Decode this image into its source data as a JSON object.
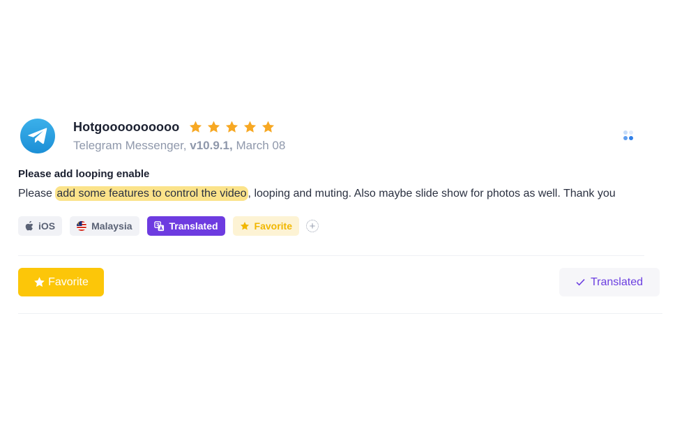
{
  "review": {
    "app_icon": "telegram-logo-icon",
    "author": "Hotgoooooooooo",
    "rating": 5,
    "rating_max": 5,
    "star_color": "#f7a823",
    "meta": {
      "app_name": "Telegram Messenger,",
      "version": "v10.9.1,",
      "date": "March 08"
    },
    "title": "Please add looping enable",
    "body": {
      "before": "Please ",
      "highlighted": "add some features to control the video",
      "after": ", looping and muting. Also maybe slide show for photos as well. Thank you"
    },
    "highlight_color": "#fbe38a"
  },
  "tags": {
    "platform": {
      "icon": "apple-icon",
      "label": "iOS"
    },
    "country": {
      "icon": "malaysia-flag-icon",
      "label": "Malaysia"
    },
    "translated": {
      "icon": "translate-icon",
      "label": "Translated",
      "color": "#6d3be0"
    },
    "favorite": {
      "icon": "star-icon",
      "label": "Favorite",
      "color": "#f1b700"
    },
    "add": {
      "icon": "plus-icon"
    }
  },
  "actions": {
    "favorite_label": "Favorite",
    "favorite_color": "#fcc609",
    "translated_label": "Translated",
    "translated_color": "#6b3ee0"
  }
}
